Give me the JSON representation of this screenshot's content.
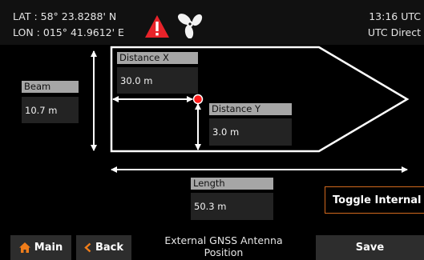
{
  "header": {
    "lat": "LAT : 58° 23.8288' N",
    "lon": "LON : 015° 41.9612' E",
    "time": "13:16 UTC",
    "time_mode": "UTC Direct",
    "alert_icon": "warning-triangle-icon",
    "fan_icon": "fan-icon",
    "alert_color": "#e8232a"
  },
  "fields": {
    "beam": {
      "label": "Beam",
      "value": "10.7 m"
    },
    "distance_x": {
      "label": "Distance X",
      "value": "30.0 m"
    },
    "distance_y": {
      "label": "Distance Y",
      "value": "3.0 m"
    },
    "length": {
      "label": "Length",
      "value": "50.3 m"
    }
  },
  "toggle": {
    "label": "Toggle Internal"
  },
  "footer": {
    "main_label": "Main",
    "back_label": "Back",
    "title_line1": "External GNSS Antenna",
    "title_line2": "Position",
    "save_label": "Save",
    "accent_color": "#f07d1a"
  }
}
